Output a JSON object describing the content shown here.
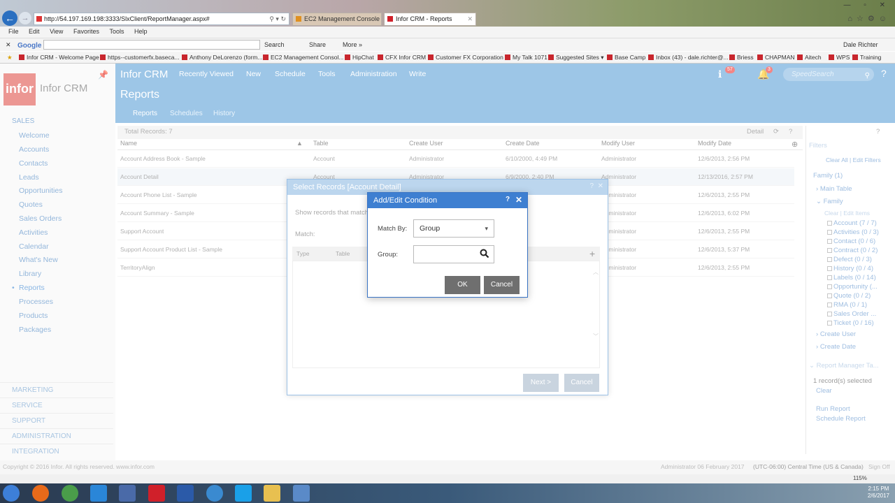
{
  "browser": {
    "address": "http://54.197.169.198:3333/SlxClient/ReportManager.aspx#",
    "tabs": [
      "EC2 Management Console",
      "Infor CRM - Reports"
    ],
    "menu": [
      "File",
      "Edit",
      "View",
      "Favorites",
      "Tools",
      "Help"
    ],
    "google_label": "Google",
    "toolbar": {
      "search": "Search",
      "share": "Share",
      "more": "More »",
      "user": "Dale Richter"
    },
    "favorites": [
      "Infor CRM - Welcome Page",
      "https--customerfx.baseca...",
      "Anthony DeLorenzo (form...",
      "EC2 Management Consol...",
      "HipChat",
      "CFX Infor CRM",
      "Customer FX Corporation",
      "My Talk 1071",
      "Suggested Sites ▾",
      "Base Camp",
      "Inbox (43) - dale.richter@...",
      "Briess",
      "CHAPMAN",
      "Aitech",
      "WPS",
      "Training"
    ],
    "zoom": "115%"
  },
  "app": {
    "title": "Infor CRM",
    "nav": [
      "Recently Viewed",
      "New",
      "Schedule",
      "Tools",
      "Administration",
      "Write"
    ],
    "badges": {
      "alerts": "57",
      "notifications": "3"
    },
    "speedsearch_placeholder": "SpeedSearch",
    "logo_text": "infor",
    "logo_caption": "Infor CRM"
  },
  "sidebar": {
    "sales_header": "SALES",
    "items": [
      "Welcome",
      "Accounts",
      "Contacts",
      "Leads",
      "Opportunities",
      "Quotes",
      "Sales Orders",
      "Activities",
      "Calendar",
      "What's New",
      "Library",
      "Reports",
      "Processes",
      "Products",
      "Packages"
    ],
    "sections": [
      "MARKETING",
      "SERVICE",
      "SUPPORT",
      "ADMINISTRATION",
      "INTEGRATION"
    ]
  },
  "page": {
    "title": "Reports",
    "tabs": [
      "Reports",
      "Schedules",
      "History"
    ],
    "total_records": "Total Records: 7",
    "detail": "Detail"
  },
  "grid": {
    "columns": [
      "Name",
      "Table",
      "Create User",
      "Create Date",
      "Modify User",
      "Modify Date"
    ],
    "rows": [
      [
        "Account Address Book - Sample",
        "Account",
        "Administrator",
        "6/10/2000, 4:49 PM",
        "Administrator",
        "12/6/2013, 2:56 PM"
      ],
      [
        "Account Detail",
        "Account",
        "Administrator",
        "6/9/2000, 2:40 PM",
        "Administrator",
        "12/13/2016, 2:57 PM"
      ],
      [
        "Account Phone List - Sample",
        "",
        "",
        "",
        "Administrator",
        "12/6/2013, 2:55 PM"
      ],
      [
        "Account Summary - Sample",
        "",
        "",
        "",
        "Administrator",
        "12/6/2013, 6:02 PM"
      ],
      [
        "Support Account",
        "",
        "",
        "",
        "Administrator",
        "12/6/2013, 2:55 PM"
      ],
      [
        "Support Account Product List - Sample",
        "",
        "",
        "",
        "Administrator",
        "12/6/2013, 5:37 PM"
      ],
      [
        "TerritoryAlign",
        "",
        "",
        "",
        "Administrator",
        "12/6/2013, 2:55 PM"
      ]
    ]
  },
  "filters": {
    "title": "Filters",
    "clear_edit": "Clear All | Edit Filters",
    "family_top": "Family (1)",
    "main_table": "Main Table",
    "family": "Family",
    "clear_items": "Clear | Edit Items",
    "items": [
      "Account (7 / 7)",
      "Activities (0 / 3)",
      "Contact (0 / 6)",
      "Contract (0 / 2)",
      "Defect (0 / 3)",
      "History (0 / 4)",
      "Labels (0 / 14)",
      "Opportunity (...",
      "Quote (0 / 2)",
      "RMA (0 / 1)",
      "Sales Order ...",
      "Ticket (0 / 16)"
    ],
    "create_user": "Create User",
    "create_date": "Create Date",
    "report_tasks": "Report Manager Ta...",
    "selected": "1 record(s) selected",
    "clear": "Clear",
    "run": "Run Report",
    "schedule": "Schedule Report"
  },
  "dialog_outer": {
    "title": "Select Records [Account Detail]",
    "show": "Show records that match",
    "match": "Match:",
    "col_type": "Type",
    "col_table": "Table",
    "next": "Next >",
    "cancel": "Cancel"
  },
  "dialog": {
    "title": "Add/Edit Condition",
    "match_label": "Match By:",
    "match_value": "Group",
    "group_label": "Group:",
    "group_value": "",
    "ok": "OK",
    "cancel": "Cancel"
  },
  "footer": {
    "copyright": "Copyright © 2016 Infor. All rights reserved. www.infor.com",
    "user_date": "Administrator 06 February 2017",
    "timezone": "(UTC-06:00) Central Time (US & Canada)",
    "signoff": "Sign Off"
  },
  "clock": {
    "time": "2:15 PM",
    "date": "2/6/2017"
  }
}
